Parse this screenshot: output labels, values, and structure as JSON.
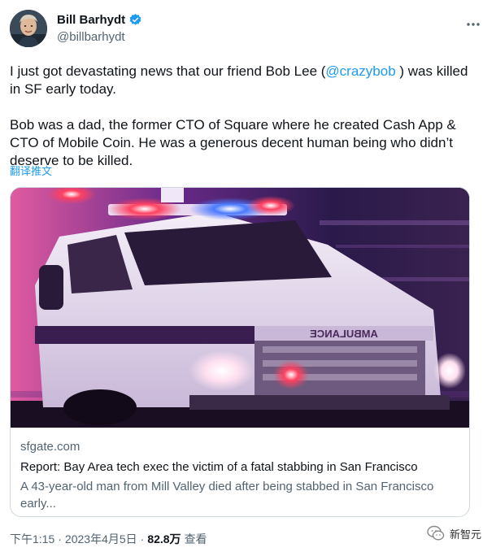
{
  "author": {
    "display_name": "Bill Barhydt",
    "handle": "@billbarhydt",
    "verified": true
  },
  "tweet": {
    "text_part1": "I just got devastating news that our friend Bob Lee (",
    "mention": "@crazybob",
    "text_part2": " ) was killed in SF early today.",
    "paragraph2": "Bob was a dad, the former CTO of Square where he created Cash App & CTO of Mobile Coin.  He was a generous decent human being who didn’t deserve to be killed.",
    "translate_label": "翻译推文"
  },
  "card": {
    "domain": "sfgate.com",
    "title": "Report: Bay Area tech exec the victim of a fatal stabbing in San Francisco",
    "description": "A 43-year-old man from Mill Valley died after being stabbed in San Francisco early...",
    "image_subject": "ambulance",
    "image_text": "AMBULANCE"
  },
  "footer": {
    "time": "下午1:15",
    "separator": "·",
    "date": "2023年4月5日",
    "views_count": "82.8万",
    "views_label": "查看"
  },
  "watermark": {
    "label": "新智元"
  },
  "colors": {
    "accent": "#1d9bf0",
    "text_primary": "#0f1419",
    "text_secondary": "#536471",
    "border": "#cfd9de"
  }
}
